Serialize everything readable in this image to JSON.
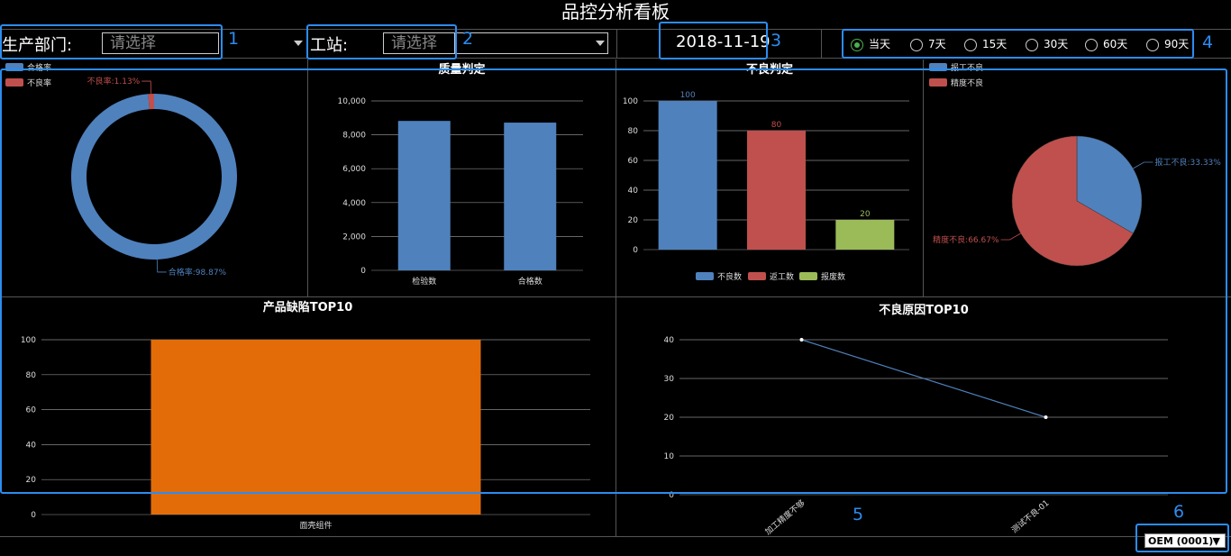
{
  "title": "品控分析看板",
  "filters": {
    "department": {
      "label": "生产部门:",
      "placeholder": "请选择"
    },
    "station": {
      "label": "工站:",
      "placeholder": "请选择"
    },
    "date": "2018-11-19",
    "periods": [
      {
        "label": "当天",
        "selected": true
      },
      {
        "label": "7天",
        "selected": false
      },
      {
        "label": "15天",
        "selected": false
      },
      {
        "label": "30天",
        "selected": false
      },
      {
        "label": "60天",
        "selected": false
      },
      {
        "label": "90天",
        "selected": false
      }
    ]
  },
  "annotations": [
    "1",
    "2",
    "3",
    "4",
    "5",
    "6"
  ],
  "footer": {
    "select_value": "OEM (0001)",
    "arrow": "▼"
  },
  "chart_data": [
    {
      "type": "pie",
      "title": "",
      "legend": [
        "合格率",
        "不良率"
      ],
      "slices": [
        {
          "name": "合格率",
          "value": 98.87,
          "label": "合格率:98.87%",
          "color": "#4f81bd"
        },
        {
          "name": "不良率",
          "value": 1.13,
          "label": "不良率:1.13%",
          "color": "#c0504d"
        }
      ],
      "donut": true
    },
    {
      "type": "bar",
      "title": "质量判定",
      "categories": [
        "检验数",
        "合格数"
      ],
      "values": [
        8820,
        8720
      ],
      "ylim": [
        0,
        10000
      ],
      "yticks": [
        "0",
        "2,000",
        "4,000",
        "6,000",
        "8,000",
        "10,000"
      ],
      "color": "#4f81bd"
    },
    {
      "type": "bar",
      "title": "不良判定",
      "categories": [
        "不良数",
        "返工数",
        "报废数"
      ],
      "values": [
        100,
        80,
        20
      ],
      "colors": [
        "#4f81bd",
        "#c0504d",
        "#9bbb59"
      ],
      "ylim": [
        0,
        100
      ],
      "yticks": [
        "0",
        "20",
        "40",
        "60",
        "80",
        "100"
      ],
      "legend": [
        "不良数",
        "返工数",
        "报废数"
      ]
    },
    {
      "type": "pie",
      "title": "",
      "legend": [
        "报工不良",
        "精度不良"
      ],
      "slices": [
        {
          "name": "报工不良",
          "value": 33.33,
          "label": "报工不良:33.33%",
          "color": "#4f81bd"
        },
        {
          "name": "精度不良",
          "value": 66.67,
          "label": "精度不良:66.67%",
          "color": "#c0504d"
        }
      ]
    },
    {
      "type": "bar",
      "title": "产品缺陷TOP10",
      "categories": [
        "面壳组件"
      ],
      "values": [
        100
      ],
      "ylim": [
        0,
        100
      ],
      "yticks": [
        "0",
        "20",
        "40",
        "60",
        "80",
        "100"
      ],
      "color": "#e36c09"
    },
    {
      "type": "line",
      "title": "不良原因TOP10",
      "categories": [
        "加工精度不够",
        "测试不良-01"
      ],
      "values": [
        40,
        20
      ],
      "ylim": [
        0,
        40
      ],
      "yticks": [
        "0",
        "10",
        "20",
        "30",
        "40"
      ],
      "color": "#4f81bd"
    }
  ]
}
